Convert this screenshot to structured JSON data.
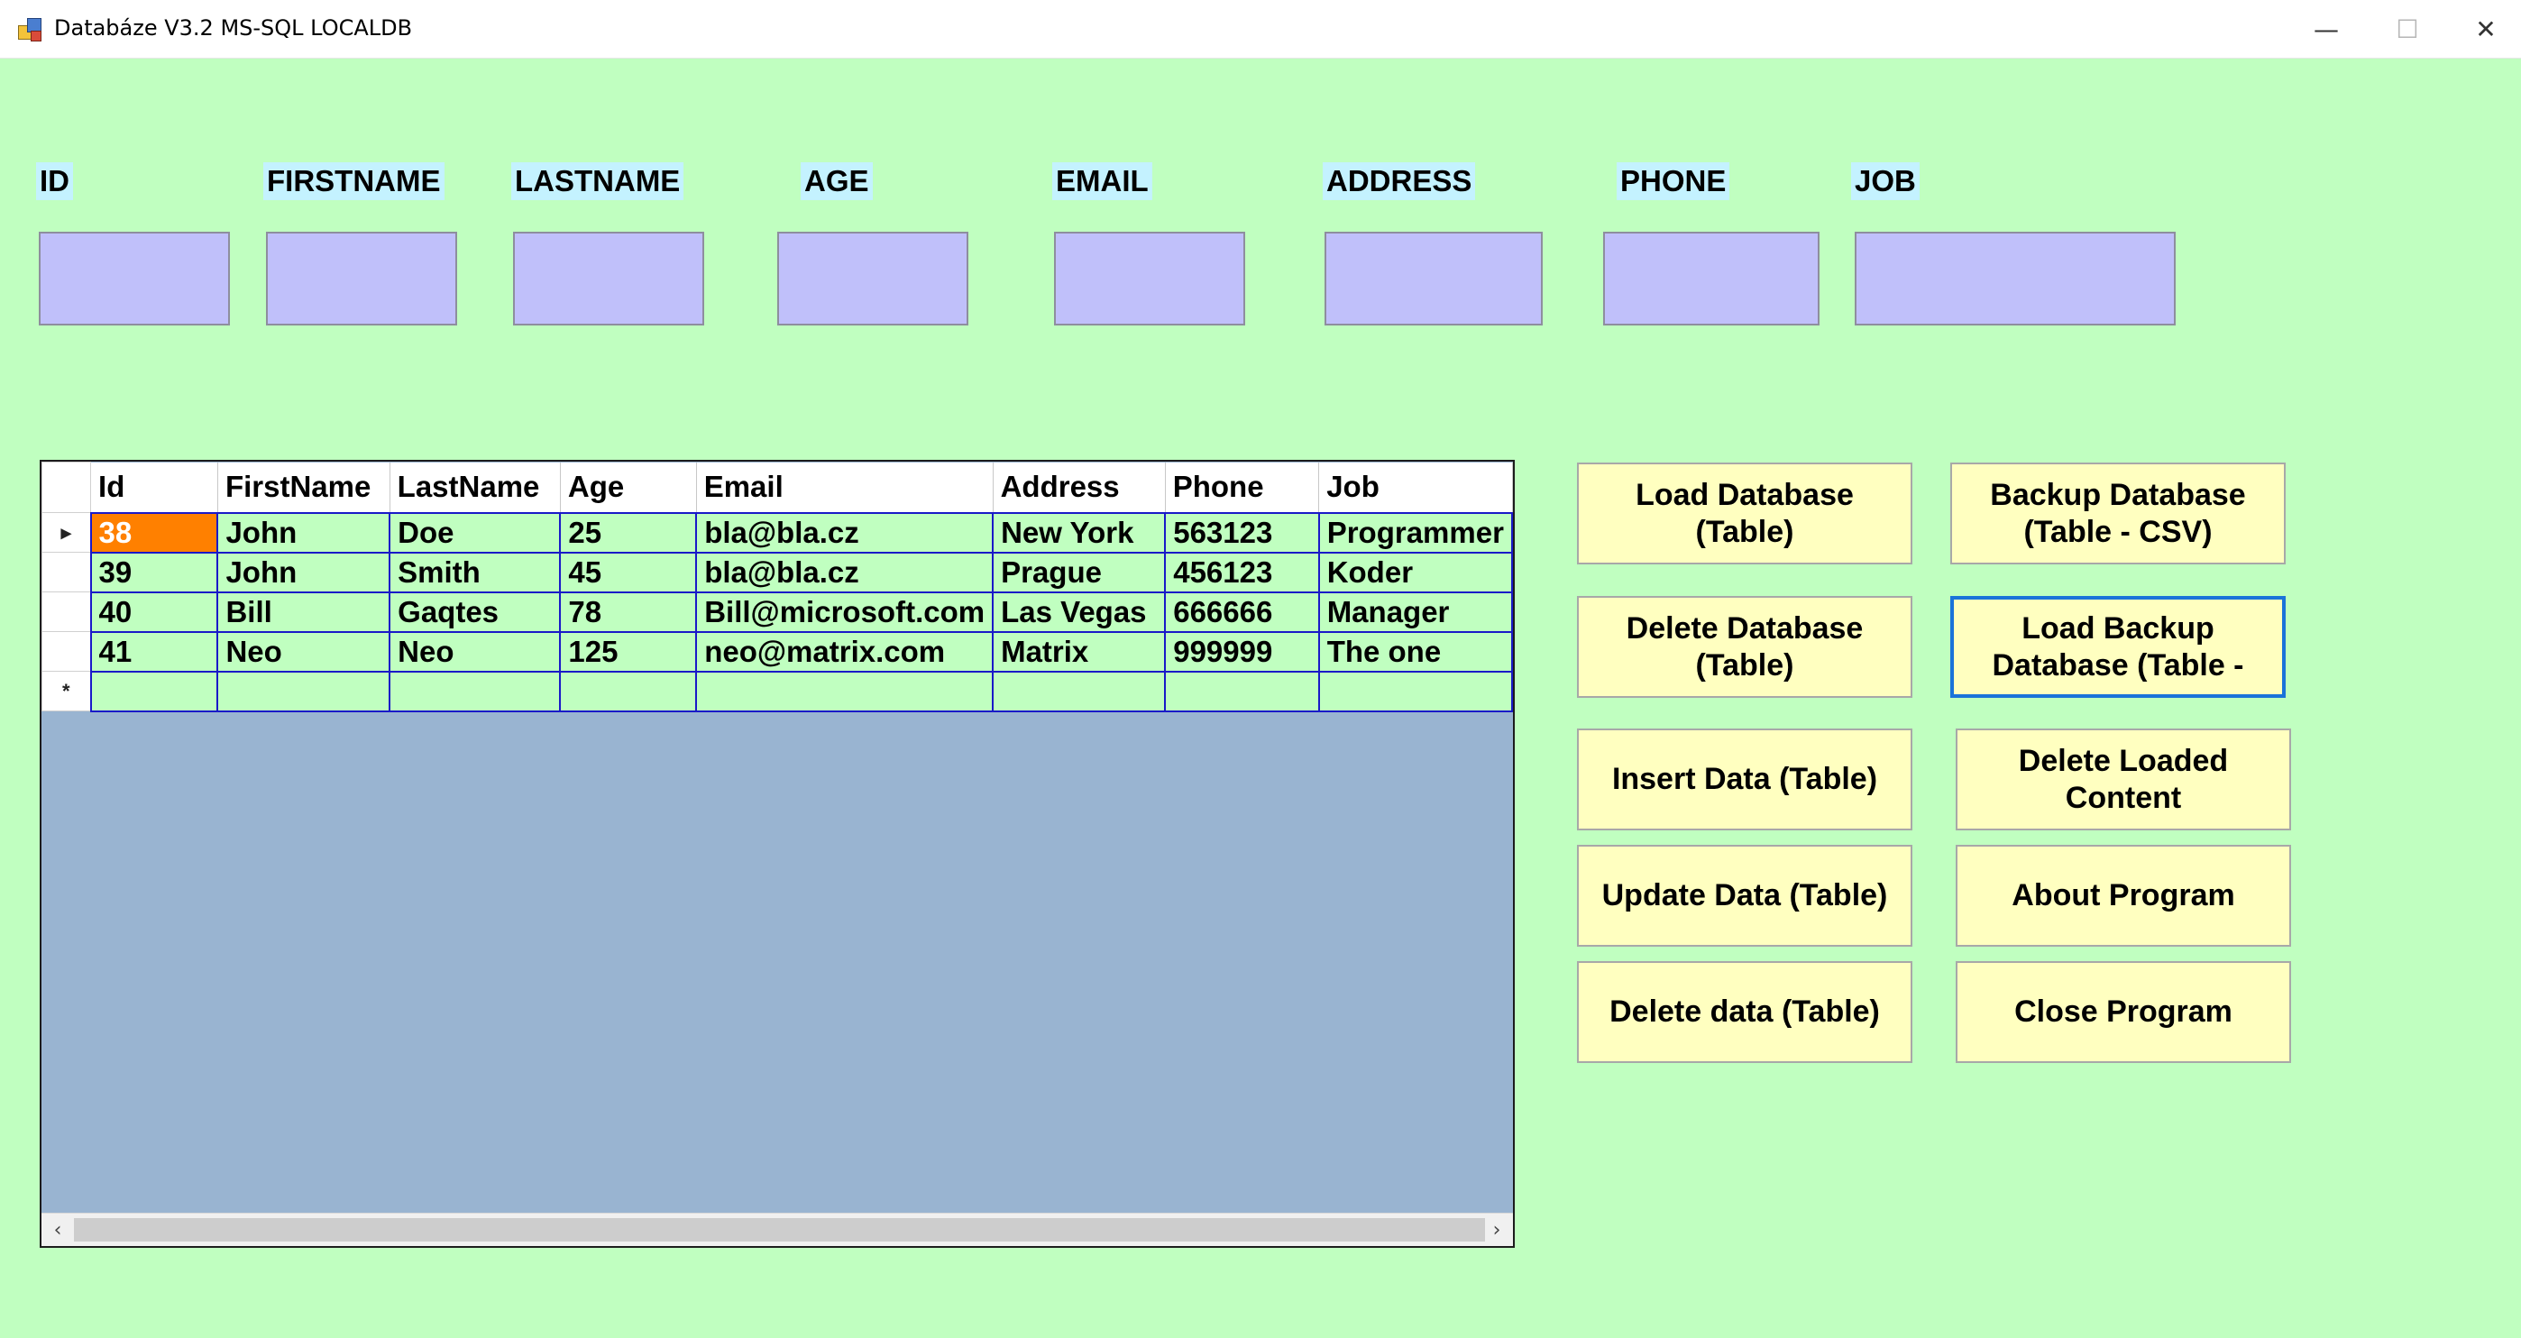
{
  "window": {
    "title": "Databáze V3.2 MS-SQL LOCALDB",
    "min_glyph": "—",
    "max_glyph": "☐",
    "close_glyph": "✕"
  },
  "fields": {
    "id_label": "ID",
    "firstname_label": "FIRSTNAME",
    "lastname_label": "LASTNAME",
    "age_label": "AGE",
    "email_label": "EMAIL",
    "address_label": "ADDRESS",
    "phone_label": "PHONE",
    "job_label": "JOB"
  },
  "grid": {
    "columns": [
      "Id",
      "FirstName",
      "LastName",
      "Age",
      "Email",
      "Address",
      "Phone",
      "Job"
    ],
    "rows": [
      {
        "indicator": "▸",
        "cells": [
          "38",
          "John",
          "Doe",
          "25",
          "bla@bla.cz",
          "New York",
          "563123",
          "Programmer"
        ]
      },
      {
        "indicator": "",
        "cells": [
          "39",
          "John",
          "Smith",
          "45",
          "bla@bla.cz",
          "Prague",
          "456123",
          "Koder"
        ]
      },
      {
        "indicator": "",
        "cells": [
          "40",
          "Bill",
          "Gaqtes",
          "78",
          "Bill@microsoft.com",
          "Las Vegas",
          "666666",
          "Manager"
        ]
      },
      {
        "indicator": "",
        "cells": [
          "41",
          "Neo",
          "Neo",
          "125",
          "neo@matrix.com",
          "Matrix",
          "999999",
          "The one"
        ]
      }
    ],
    "new_row_indicator": "*",
    "scroll_left": "‹",
    "scroll_right": "›"
  },
  "buttons": {
    "load_database": "Load Database\n(Table)",
    "backup_database": "Backup Database\n(Table - CSV)",
    "delete_database": "Delete Database\n(Table)",
    "load_backup": "Load Backup\nDatabase (Table -",
    "insert_data": "Insert Data (Table)",
    "delete_loaded": "Delete Loaded\nContent",
    "update_data": "Update Data (Table)",
    "about_program": "About Program",
    "delete_data": "Delete data (Table)",
    "close_program": "Close Program"
  },
  "colors": {
    "background": "#c0ffc0",
    "label_bg": "#c4f2ff",
    "input_bg": "#c0c0fa",
    "grid_bg": "#99b4d1",
    "grid_lines": "#1919c8",
    "selected_cell": "#ff8000",
    "button_bg": "#ffffc0",
    "focus_border": "#1a73d9"
  }
}
